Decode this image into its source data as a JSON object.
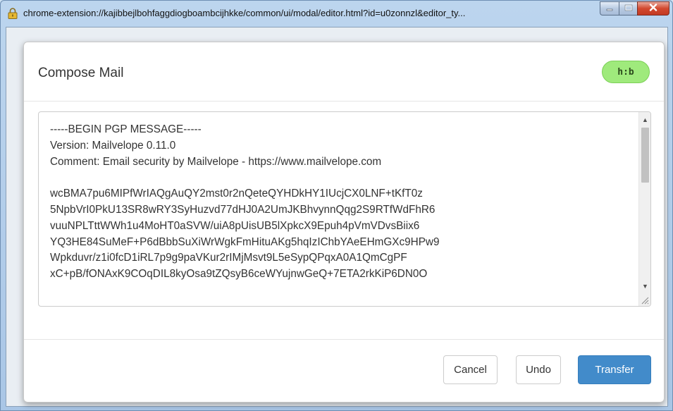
{
  "window": {
    "title": "chrome-extension://kajibbejlbohfaggdiogboambcijhkke/common/ui/modal/editor.html?id=u0zonnzl&editor_ty...",
    "lock_icon": "lock-icon",
    "controls": [
      "minimize-icon",
      "maximize-icon",
      "close-icon"
    ]
  },
  "modal": {
    "title": "Compose Mail",
    "badge": "h:b",
    "badge_color": "#9fea7c"
  },
  "editor": {
    "lines": [
      "-----BEGIN PGP MESSAGE-----",
      "Version: Mailvelope 0.11.0",
      "Comment: Email security by Mailvelope - https://www.mailvelope.com",
      "",
      "wcBMA7pu6MIPfWrIAQgAuQY2mst0r2nQeteQYHDkHY1IUcjCX0LNF+tKfT0z",
      "5NpbVrI0PkU13SR8wRY3SyHuzvd77dHJ0A2UmJKBhvynnQqg2S9RTfWdFhR6",
      "vuuNPLTttWWh1u4MoHT0aSVW/uiA8pUisUB5lXpkcX9Epuh4pVmVDvsBiix6",
      "YQ3HE84SuMeF+P6dBbbSuXiWrWgkFmHituAKg5hqIzIChbYAeEHmGXc9HPw9",
      "Wpkduvr/z1i0fcD1iRL7p9g9paVKur2rIMjMsvt9L5eSypQPqxA0A1QmCgPF",
      "xC+pB/fONAxK9COqDIL8kyOsa9tZQsyB6ceWYujnwGeQ+7ETA2rkKiP6DN0O"
    ],
    "scroll": {
      "up_icon": "scroll-up-icon",
      "down_icon": "scroll-down-icon"
    }
  },
  "footer": {
    "cancel_label": "Cancel",
    "undo_label": "Undo",
    "transfer_label": "Transfer",
    "primary_color": "#428bca"
  }
}
